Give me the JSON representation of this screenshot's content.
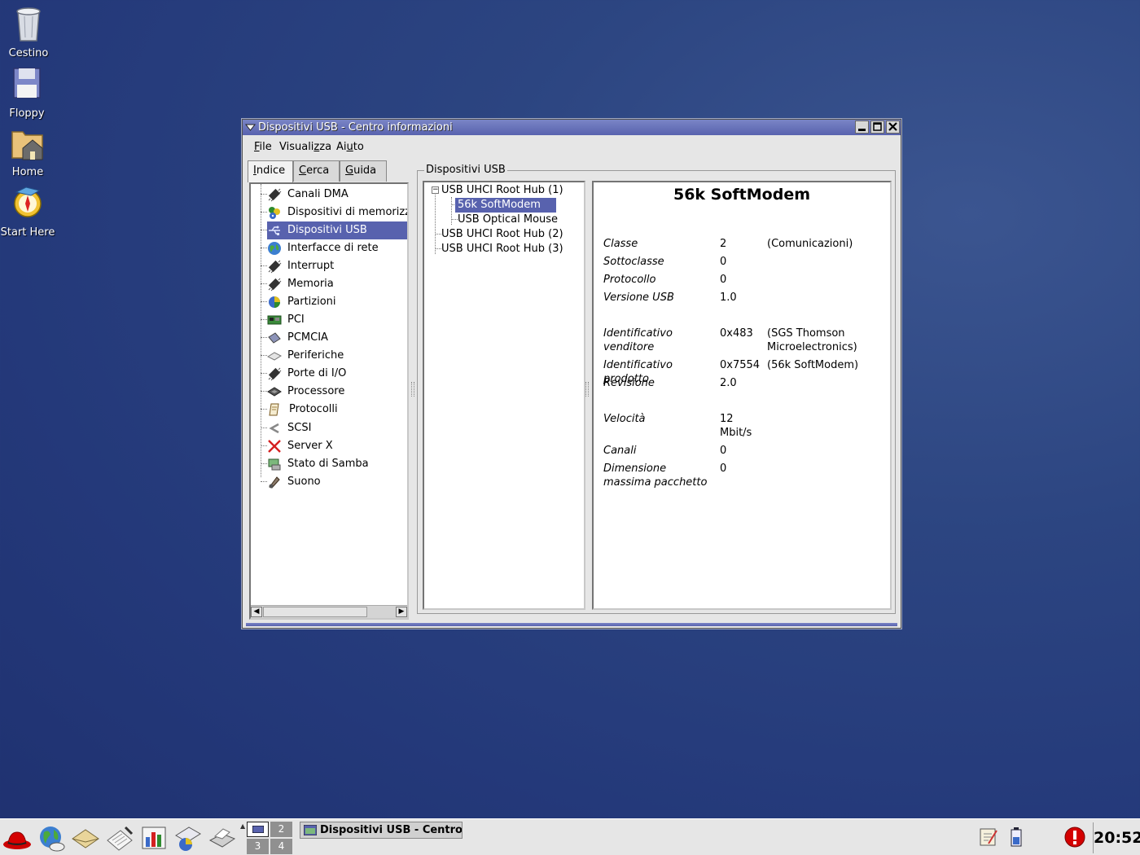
{
  "desktop": {
    "icons": [
      {
        "label": "Cestino",
        "icon": "trash-icon"
      },
      {
        "label": "Floppy",
        "icon": "floppy-icon"
      },
      {
        "label": "Home",
        "icon": "home-folder-icon"
      },
      {
        "label": "Start Here",
        "icon": "start-here-icon"
      }
    ]
  },
  "window": {
    "title": "Dispositivi USB - Centro informazioni",
    "menu": {
      "file_pre": "",
      "file_u": "F",
      "file_post": "ile",
      "view_pre": "Visuali",
      "view_u": "z",
      "view_post": "za",
      "help_pre": "Ai",
      "help_u": "u",
      "help_post": "to"
    },
    "tabs": [
      {
        "pre": "",
        "u": "I",
        "post": "ndice"
      },
      {
        "pre": "",
        "u": "C",
        "post": "erca"
      },
      {
        "pre": "",
        "u": "G",
        "post": "uida"
      }
    ],
    "index_items": [
      {
        "label": "Canali DMA",
        "icon": "chip-icon"
      },
      {
        "label": "Dispositivi di memorizzazione",
        "icon": "storage-devices-icon"
      },
      {
        "label": "Dispositivi USB",
        "icon": "usb-icon"
      },
      {
        "label": "Interfacce di rete",
        "icon": "globe-icon"
      },
      {
        "label": "Interrupt",
        "icon": "chip-icon"
      },
      {
        "label": "Memoria",
        "icon": "chip-icon"
      },
      {
        "label": "Partizioni",
        "icon": "partitions-icon"
      },
      {
        "label": "PCI",
        "icon": "pci-card-icon"
      },
      {
        "label": "PCMCIA",
        "icon": "pcmcia-card-icon"
      },
      {
        "label": "Periferiche",
        "icon": "peripherals-icon"
      },
      {
        "label": "Porte di I/O",
        "icon": "chip-icon"
      },
      {
        "label": "Processore",
        "icon": "processor-icon"
      },
      {
        "label": "Protocolli",
        "icon": "scroll-icon"
      },
      {
        "label": "SCSI",
        "icon": "scsi-icon"
      },
      {
        "label": "Server X",
        "icon": "x-server-icon"
      },
      {
        "label": "Stato di Samba",
        "icon": "samba-icon"
      },
      {
        "label": "Suono",
        "icon": "sound-icon"
      }
    ],
    "usb_group_title": "Dispositivi USB",
    "usb_tree": [
      {
        "label": "USB UHCI Root Hub (1)",
        "level": 0,
        "expanded": true
      },
      {
        "label": "56k SoftModem",
        "level": 1,
        "selected": true
      },
      {
        "label": "USB Optical Mouse",
        "level": 1
      },
      {
        "label": "USB UHCI Root Hub (2)",
        "level": 0
      },
      {
        "label": "USB UHCI Root Hub (3)",
        "level": 0
      }
    ],
    "details": {
      "title": "56k SoftModem",
      "classe": {
        "label": "Classe",
        "value": "2",
        "extra": "(Comunicazioni)"
      },
      "sottoclasse": {
        "label": "Sottoclasse",
        "value": "0"
      },
      "protocollo": {
        "label": "Protocollo",
        "value": "0"
      },
      "versione": {
        "label": "Versione USB",
        "value": "1.0"
      },
      "venditore": {
        "label": "Identificativo venditore",
        "value": "0x483",
        "extra": "(SGS Thomson Microelectronics)"
      },
      "prodotto": {
        "label": "Identificativo prodotto",
        "value": "0x7554",
        "extra": "(56k SoftModem)"
      },
      "revisione": {
        "label": "Revisione",
        "value": "2.0"
      },
      "velocita": {
        "label": "Velocità",
        "value": "12 Mbit/s"
      },
      "canali": {
        "label": "Canali",
        "value": "0"
      },
      "dimensione": {
        "label": "Dimensione massima pacchetto",
        "value": "0"
      }
    }
  },
  "taskbar": {
    "launchers": [
      "redhat-menu-icon",
      "web-browser-icon",
      "email-icon",
      "text-editor-icon",
      "spreadsheet-icon",
      "presentation-icon",
      "printer-icon"
    ],
    "workspaces": [
      "1",
      "2",
      "3",
      "4"
    ],
    "task_label": "Dispositivi USB - Centro informazioni",
    "clock": "20:52"
  },
  "colors": {
    "selection": "#5862ae",
    "desktop": "#2c4581"
  }
}
